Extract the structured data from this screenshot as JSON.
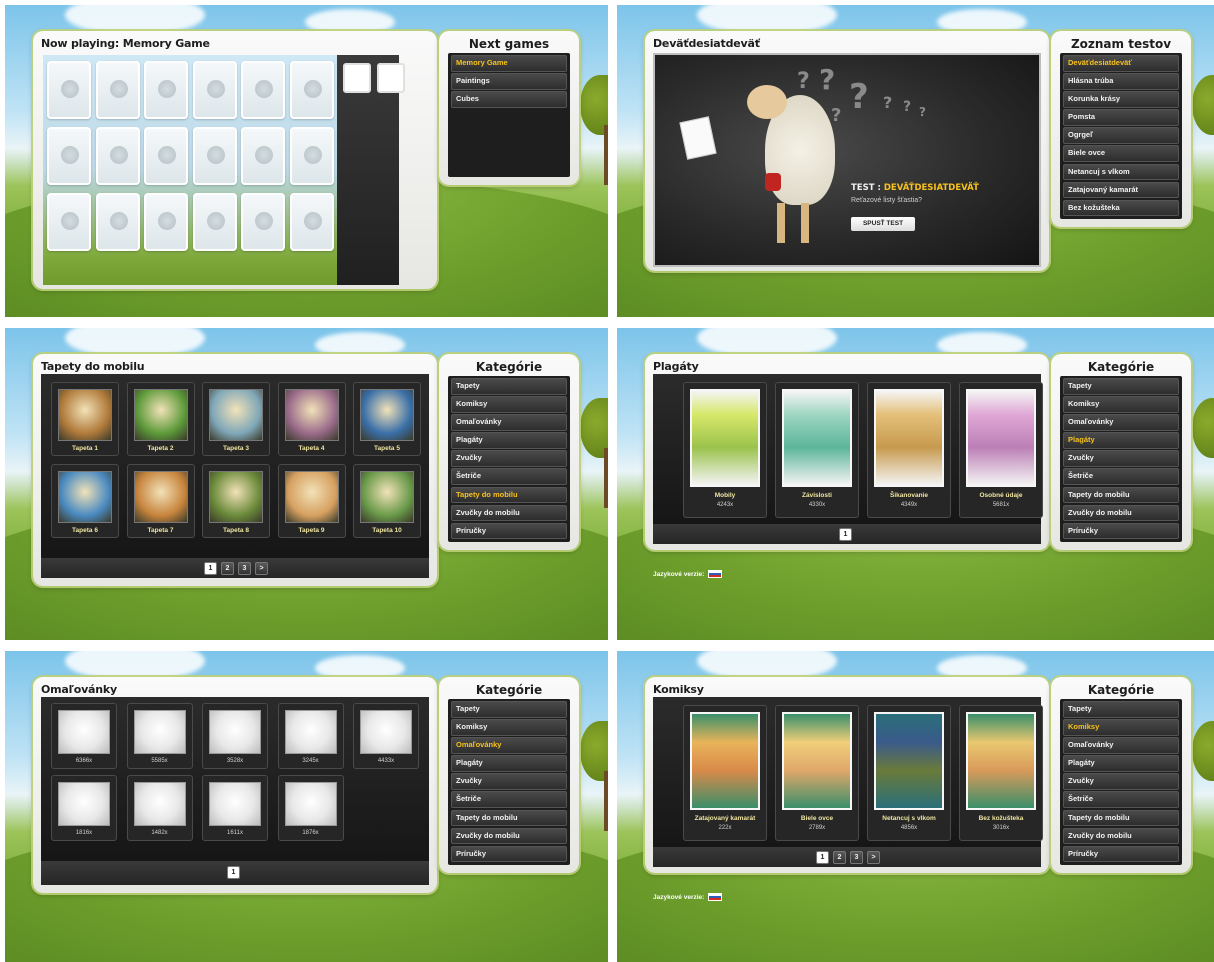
{
  "screens": {
    "memory": {
      "title": "Now playing: Memory Game",
      "side_title": "Next games",
      "menu": [
        "Memory Game",
        "Paintings",
        "Cubes"
      ],
      "active_index": 0
    },
    "quiz": {
      "title": "Deväťdesiatdeväť",
      "side_title": "Zoznam testov",
      "menu": [
        "Deväťdesiatdeväť",
        "Hlásna trúba",
        "Korunka krásy",
        "Pomsta",
        "Ogrgeľ",
        "Biele ovce",
        "Netancuj s vlkom",
        "Zatajovaný kamarát",
        "Bez kožušteka"
      ],
      "active_index": 0,
      "test_label": "TEST :",
      "test_name": "DEVÄŤDESIATDEVÄŤ",
      "question": "Reťazové listy šťastia?",
      "button": "SPUSŤ TEST"
    },
    "wallpapers": {
      "title": "Tapety do mobilu",
      "side_title": "Kategórie",
      "items": [
        "Tapeta 1",
        "Tapeta 2",
        "Tapeta 3",
        "Tapeta 4",
        "Tapeta 5",
        "Tapeta 6",
        "Tapeta 7",
        "Tapeta 8",
        "Tapeta 9",
        "Tapeta 10"
      ],
      "pages": [
        "1",
        "2",
        "3",
        ">"
      ],
      "active_page": 0,
      "active_category": 6
    },
    "posters": {
      "title": "Plagáty",
      "side_title": "Kategórie",
      "items": [
        {
          "name": "Mobily",
          "count": "4243x"
        },
        {
          "name": "Závislosti",
          "count": "4330x"
        },
        {
          "name": "Šikanovanie",
          "count": "4349x"
        },
        {
          "name": "Osobné údaje",
          "count": "5681x"
        }
      ],
      "pages": [
        "1"
      ],
      "active_page": 0,
      "active_category": 3,
      "lang_label": "Jazykové verzie:"
    },
    "coloring": {
      "title": "Omaľovánky",
      "side_title": "Kategórie",
      "counts": [
        "6366x",
        "5585x",
        "3528x",
        "3245x",
        "4433x",
        "1816x",
        "1482x",
        "1611x",
        "1876x"
      ],
      "pages": [
        "1"
      ],
      "active_page": 0,
      "active_category": 2
    },
    "comics": {
      "title": "Komiksy",
      "side_title": "Kategórie",
      "items": [
        {
          "name": "Zatajovaný kamarát",
          "count": "222x"
        },
        {
          "name": "Biele ovce",
          "count": "2789x"
        },
        {
          "name": "Netancuj s vlkom",
          "count": "4856x"
        },
        {
          "name": "Bez kožušteka",
          "count": "3016x"
        }
      ],
      "pages": [
        "1",
        "2",
        "3",
        ">"
      ],
      "active_page": 0,
      "active_category": 1,
      "lang_label": "Jazykové verzie:"
    }
  },
  "categories": [
    "Tapety",
    "Komiksy",
    "Omaľovánky",
    "Plagáty",
    "Zvučky",
    "Šetriče",
    "Tapety do mobilu",
    "Zvučky do mobilu",
    "Príručky"
  ],
  "colors": {
    "accent": "#f8c21c",
    "menu_bg": "#2d2d2d",
    "panel_bg": "#f2f2ee",
    "frame": "#bed278"
  }
}
